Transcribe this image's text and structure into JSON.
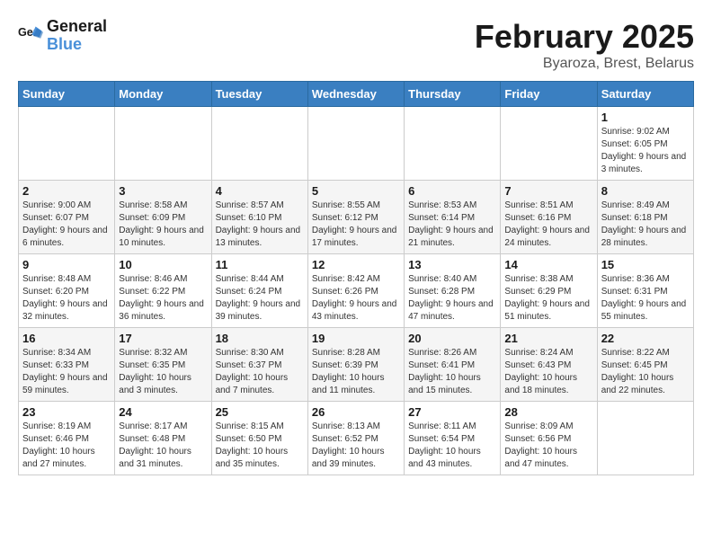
{
  "logo": {
    "line1": "General",
    "line2": "Blue"
  },
  "title": "February 2025",
  "subtitle": "Byaroza, Brest, Belarus",
  "weekdays": [
    "Sunday",
    "Monday",
    "Tuesday",
    "Wednesday",
    "Thursday",
    "Friday",
    "Saturday"
  ],
  "weeks": [
    [
      {
        "day": "",
        "info": ""
      },
      {
        "day": "",
        "info": ""
      },
      {
        "day": "",
        "info": ""
      },
      {
        "day": "",
        "info": ""
      },
      {
        "day": "",
        "info": ""
      },
      {
        "day": "",
        "info": ""
      },
      {
        "day": "1",
        "info": "Sunrise: 9:02 AM\nSunset: 6:05 PM\nDaylight: 9 hours and 3 minutes."
      }
    ],
    [
      {
        "day": "2",
        "info": "Sunrise: 9:00 AM\nSunset: 6:07 PM\nDaylight: 9 hours and 6 minutes."
      },
      {
        "day": "3",
        "info": "Sunrise: 8:58 AM\nSunset: 6:09 PM\nDaylight: 9 hours and 10 minutes."
      },
      {
        "day": "4",
        "info": "Sunrise: 8:57 AM\nSunset: 6:10 PM\nDaylight: 9 hours and 13 minutes."
      },
      {
        "day": "5",
        "info": "Sunrise: 8:55 AM\nSunset: 6:12 PM\nDaylight: 9 hours and 17 minutes."
      },
      {
        "day": "6",
        "info": "Sunrise: 8:53 AM\nSunset: 6:14 PM\nDaylight: 9 hours and 21 minutes."
      },
      {
        "day": "7",
        "info": "Sunrise: 8:51 AM\nSunset: 6:16 PM\nDaylight: 9 hours and 24 minutes."
      },
      {
        "day": "8",
        "info": "Sunrise: 8:49 AM\nSunset: 6:18 PM\nDaylight: 9 hours and 28 minutes."
      }
    ],
    [
      {
        "day": "9",
        "info": "Sunrise: 8:48 AM\nSunset: 6:20 PM\nDaylight: 9 hours and 32 minutes."
      },
      {
        "day": "10",
        "info": "Sunrise: 8:46 AM\nSunset: 6:22 PM\nDaylight: 9 hours and 36 minutes."
      },
      {
        "day": "11",
        "info": "Sunrise: 8:44 AM\nSunset: 6:24 PM\nDaylight: 9 hours and 39 minutes."
      },
      {
        "day": "12",
        "info": "Sunrise: 8:42 AM\nSunset: 6:26 PM\nDaylight: 9 hours and 43 minutes."
      },
      {
        "day": "13",
        "info": "Sunrise: 8:40 AM\nSunset: 6:28 PM\nDaylight: 9 hours and 47 minutes."
      },
      {
        "day": "14",
        "info": "Sunrise: 8:38 AM\nSunset: 6:29 PM\nDaylight: 9 hours and 51 minutes."
      },
      {
        "day": "15",
        "info": "Sunrise: 8:36 AM\nSunset: 6:31 PM\nDaylight: 9 hours and 55 minutes."
      }
    ],
    [
      {
        "day": "16",
        "info": "Sunrise: 8:34 AM\nSunset: 6:33 PM\nDaylight: 9 hours and 59 minutes."
      },
      {
        "day": "17",
        "info": "Sunrise: 8:32 AM\nSunset: 6:35 PM\nDaylight: 10 hours and 3 minutes."
      },
      {
        "day": "18",
        "info": "Sunrise: 8:30 AM\nSunset: 6:37 PM\nDaylight: 10 hours and 7 minutes."
      },
      {
        "day": "19",
        "info": "Sunrise: 8:28 AM\nSunset: 6:39 PM\nDaylight: 10 hours and 11 minutes."
      },
      {
        "day": "20",
        "info": "Sunrise: 8:26 AM\nSunset: 6:41 PM\nDaylight: 10 hours and 15 minutes."
      },
      {
        "day": "21",
        "info": "Sunrise: 8:24 AM\nSunset: 6:43 PM\nDaylight: 10 hours and 18 minutes."
      },
      {
        "day": "22",
        "info": "Sunrise: 8:22 AM\nSunset: 6:45 PM\nDaylight: 10 hours and 22 minutes."
      }
    ],
    [
      {
        "day": "23",
        "info": "Sunrise: 8:19 AM\nSunset: 6:46 PM\nDaylight: 10 hours and 27 minutes."
      },
      {
        "day": "24",
        "info": "Sunrise: 8:17 AM\nSunset: 6:48 PM\nDaylight: 10 hours and 31 minutes."
      },
      {
        "day": "25",
        "info": "Sunrise: 8:15 AM\nSunset: 6:50 PM\nDaylight: 10 hours and 35 minutes."
      },
      {
        "day": "26",
        "info": "Sunrise: 8:13 AM\nSunset: 6:52 PM\nDaylight: 10 hours and 39 minutes."
      },
      {
        "day": "27",
        "info": "Sunrise: 8:11 AM\nSunset: 6:54 PM\nDaylight: 10 hours and 43 minutes."
      },
      {
        "day": "28",
        "info": "Sunrise: 8:09 AM\nSunset: 6:56 PM\nDaylight: 10 hours and 47 minutes."
      },
      {
        "day": "",
        "info": ""
      }
    ]
  ]
}
